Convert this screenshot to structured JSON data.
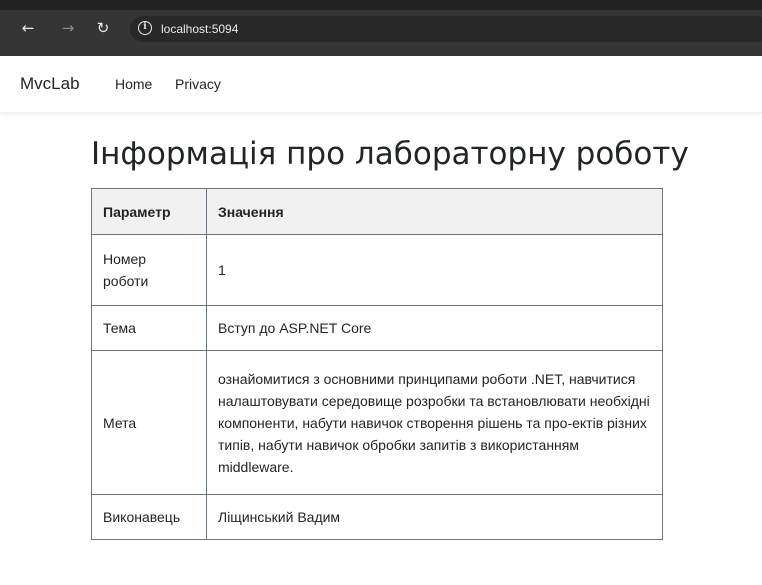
{
  "browser": {
    "url": "localhost:5094",
    "back_icon": "←",
    "forward_icon": "→",
    "reload_icon": "↻",
    "info_icon": "i"
  },
  "navbar": {
    "brand": "MvcLab",
    "links": [
      "Home",
      "Privacy"
    ]
  },
  "main": {
    "title": "Інформація про лабораторну роботу",
    "table": {
      "headers": [
        "Параметр",
        "Значення"
      ],
      "rows": [
        {
          "param": "Номер роботи",
          "value": "1"
        },
        {
          "param": "Тема",
          "value": "Вступ до ASP.NET Core"
        },
        {
          "param": "Мета",
          "value": "ознайомитися з основними принципами роботи .NET, навчитися налаштовувати середовище розробки та встановлювати необхідні компоненти, набути навичок створення рішень та про-ектів різних типів, набути навичок обробки запитів з використанням middleware."
        },
        {
          "param": "Виконавець",
          "value": "Ліщинський Вадим"
        }
      ]
    }
  }
}
